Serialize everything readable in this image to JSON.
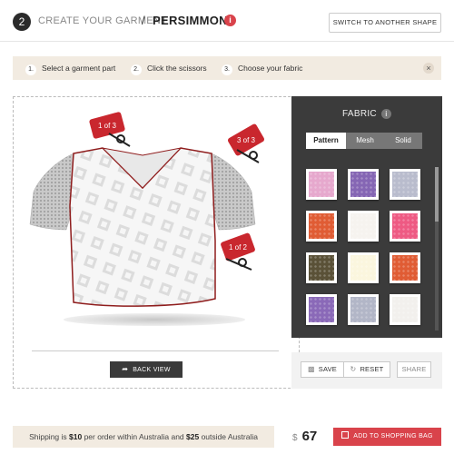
{
  "header": {
    "step_number": "2",
    "create_label": "CREATE YOUR GARMENT",
    "separator": "/",
    "garment_name": "PERSIMMON",
    "info_glyph": "i",
    "switch_shape_label": "SWITCH TO ANOTHER SHAPE"
  },
  "steps": [
    {
      "num": "1.",
      "label": "Select a garment part"
    },
    {
      "num": "2.",
      "label": "Click the scissors"
    },
    {
      "num": "3.",
      "label": "Choose your fabric"
    }
  ],
  "steps_close": "×",
  "canvas": {
    "scissor_labels": [
      "1 of 3",
      "3 of 3",
      "1 of 2"
    ],
    "back_view_label": "BACK VIEW"
  },
  "fabric": {
    "title": "FABRIC",
    "info_glyph": "i",
    "tabs": [
      {
        "label": "Pattern",
        "active": true
      },
      {
        "label": "Mesh",
        "active": false
      },
      {
        "label": "Solid",
        "active": false
      }
    ],
    "swatch_colors": [
      "#e6a8cd",
      "#8566b4",
      "#b9bccd",
      "#e05c34",
      "#f6f3ef",
      "#ee5a83",
      "#5a5137",
      "#fbf6de",
      "#e05c34",
      "#8a69b8",
      "#b2b6c7",
      "#f2f0ed"
    ]
  },
  "actions": {
    "save_label": "SAVE",
    "reset_label": "RESET",
    "share_label": "SHARE"
  },
  "footer": {
    "shipping_prefix": "Shipping is ",
    "shipping_au": "$10",
    "shipping_mid": " per order within Australia and ",
    "shipping_intl": "$25",
    "shipping_suffix": " outside Australia",
    "currency": "$",
    "price": "67",
    "cart_label": "ADD TO SHOPPING BAG"
  },
  "colors": {
    "accent": "#d9434b",
    "panel": "#3b3b3b",
    "bar_bg": "#f2ebe1"
  }
}
